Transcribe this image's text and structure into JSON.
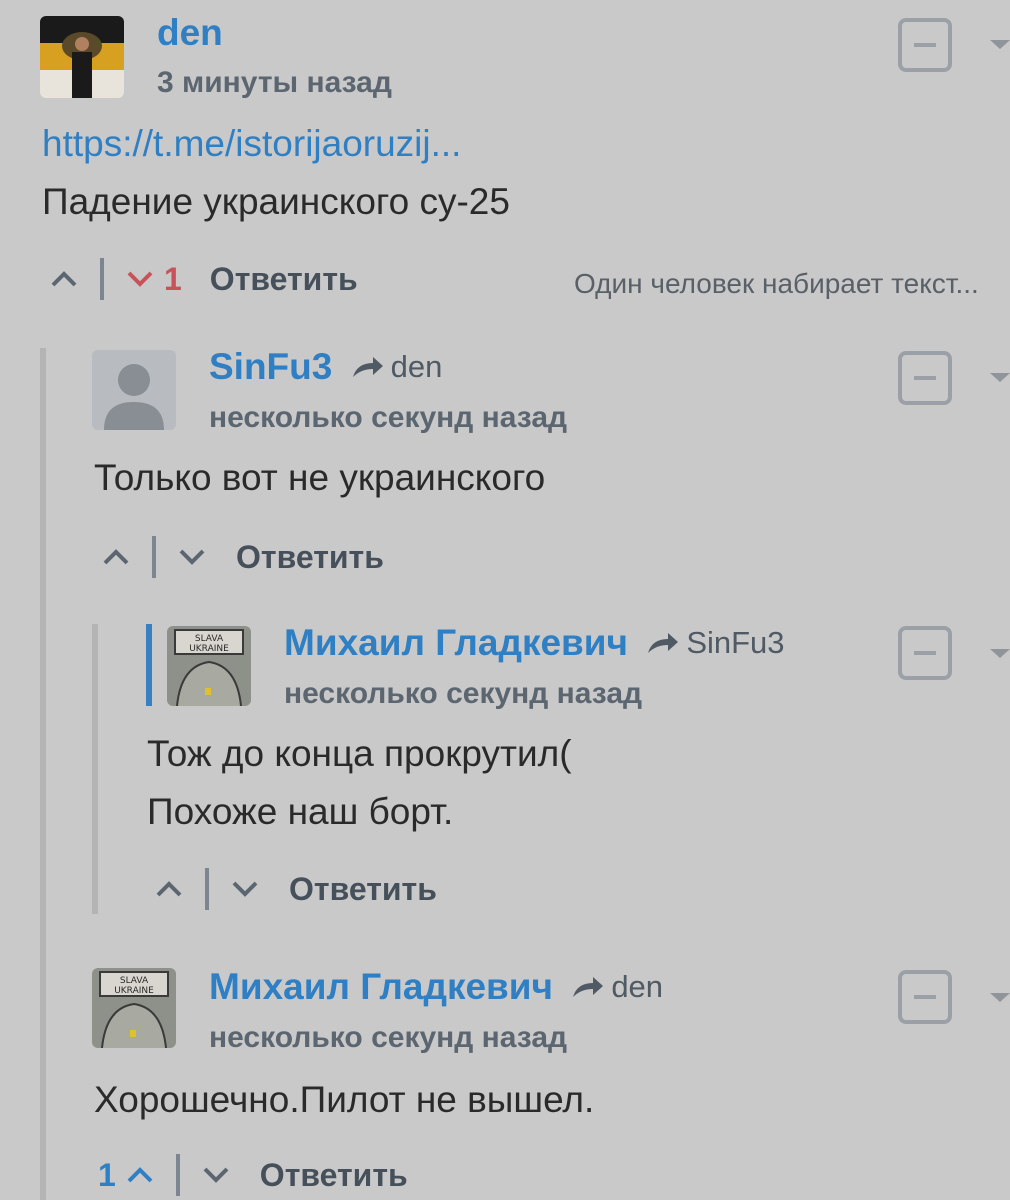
{
  "comments": [
    {
      "author": "den",
      "time": "3 минуты назад",
      "link": "https://t.me/istorijaoruzij...",
      "text": "Падение украинского су-25",
      "downvotes": "1",
      "reply": "Ответить",
      "typing": "Один человек набирает текст..."
    },
    {
      "author": "SinFu3",
      "reply_to": "den",
      "time": "несколько секунд назад",
      "text": "Только вот не украинского",
      "reply": "Ответить"
    },
    {
      "author": "Михаил Гладкевич",
      "reply_to": "SinFu3",
      "time": "несколько секунд назад",
      "text_line1": "Тож до конца прокрутил(",
      "text_line2": "Похоже наш борт.",
      "reply": "Ответить"
    },
    {
      "author": "Михаил Гладкевич",
      "reply_to": "den",
      "time": "несколько секунд назад",
      "text": "Хорошечно.Пилот не вышел.",
      "upvotes": "1",
      "reply": "Ответить"
    }
  ],
  "avatar_text": "SLAVA UKRAINE",
  "colors": {
    "background": "#c9c9c9",
    "author": "#2f7fc4",
    "downvote": "#c8525a",
    "thread_line_active": "#3a7fc0"
  },
  "icons": [
    "chevron-up-icon",
    "chevron-down-icon",
    "reply-arrow-icon",
    "collapse-icon",
    "menu-caret-icon"
  ]
}
